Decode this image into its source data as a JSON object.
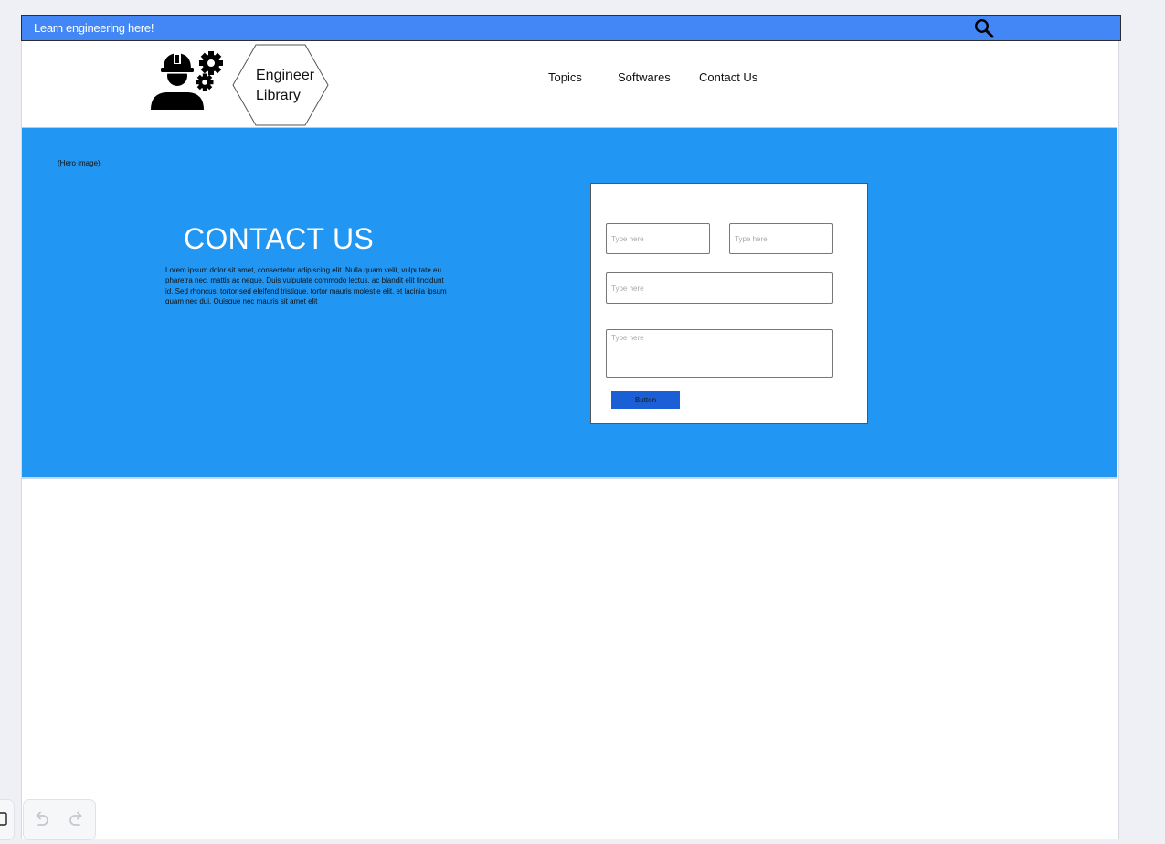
{
  "topbar": {
    "tagline": "Learn engineering here!",
    "search_icon": "search-icon"
  },
  "header": {
    "logo_icon": "engineer-with-gears-icon",
    "brand_line1": "Engineer",
    "brand_line2": "Library",
    "nav": [
      {
        "label": "Topics"
      },
      {
        "label": "Softwares"
      },
      {
        "label": "Contact Us"
      }
    ]
  },
  "hero": {
    "caption": "(Hero image)",
    "title": "CONTACT US",
    "body": "Lorem ipsum dolor sit amet, consectetur adipiscing elit. Nulla quam velit, vulputate eu pharetra nec, mattis ac neque. Duis vulputate commodo lectus, ac blandit elit tincidunt id. Sed rhoncus, tortor sed eleifend tristique, tortor mauris molestie elit, et lacinia ipsum quam nec dui. Quisque nec mauris sit amet elit"
  },
  "form": {
    "fields": [
      {
        "placeholder": "Type here",
        "value": ""
      },
      {
        "placeholder": "Type here",
        "value": ""
      },
      {
        "placeholder": "Type here",
        "value": ""
      },
      {
        "placeholder": "Type here",
        "value": ""
      }
    ],
    "button_label": "Button"
  },
  "toolbar": {
    "undo_icon": "undo-icon",
    "redo_icon": "redo-icon"
  },
  "colors": {
    "topbar": "#4287f5",
    "hero": "#2196f3",
    "button": "#1a5fd6",
    "page_background": "#eef0f5"
  }
}
